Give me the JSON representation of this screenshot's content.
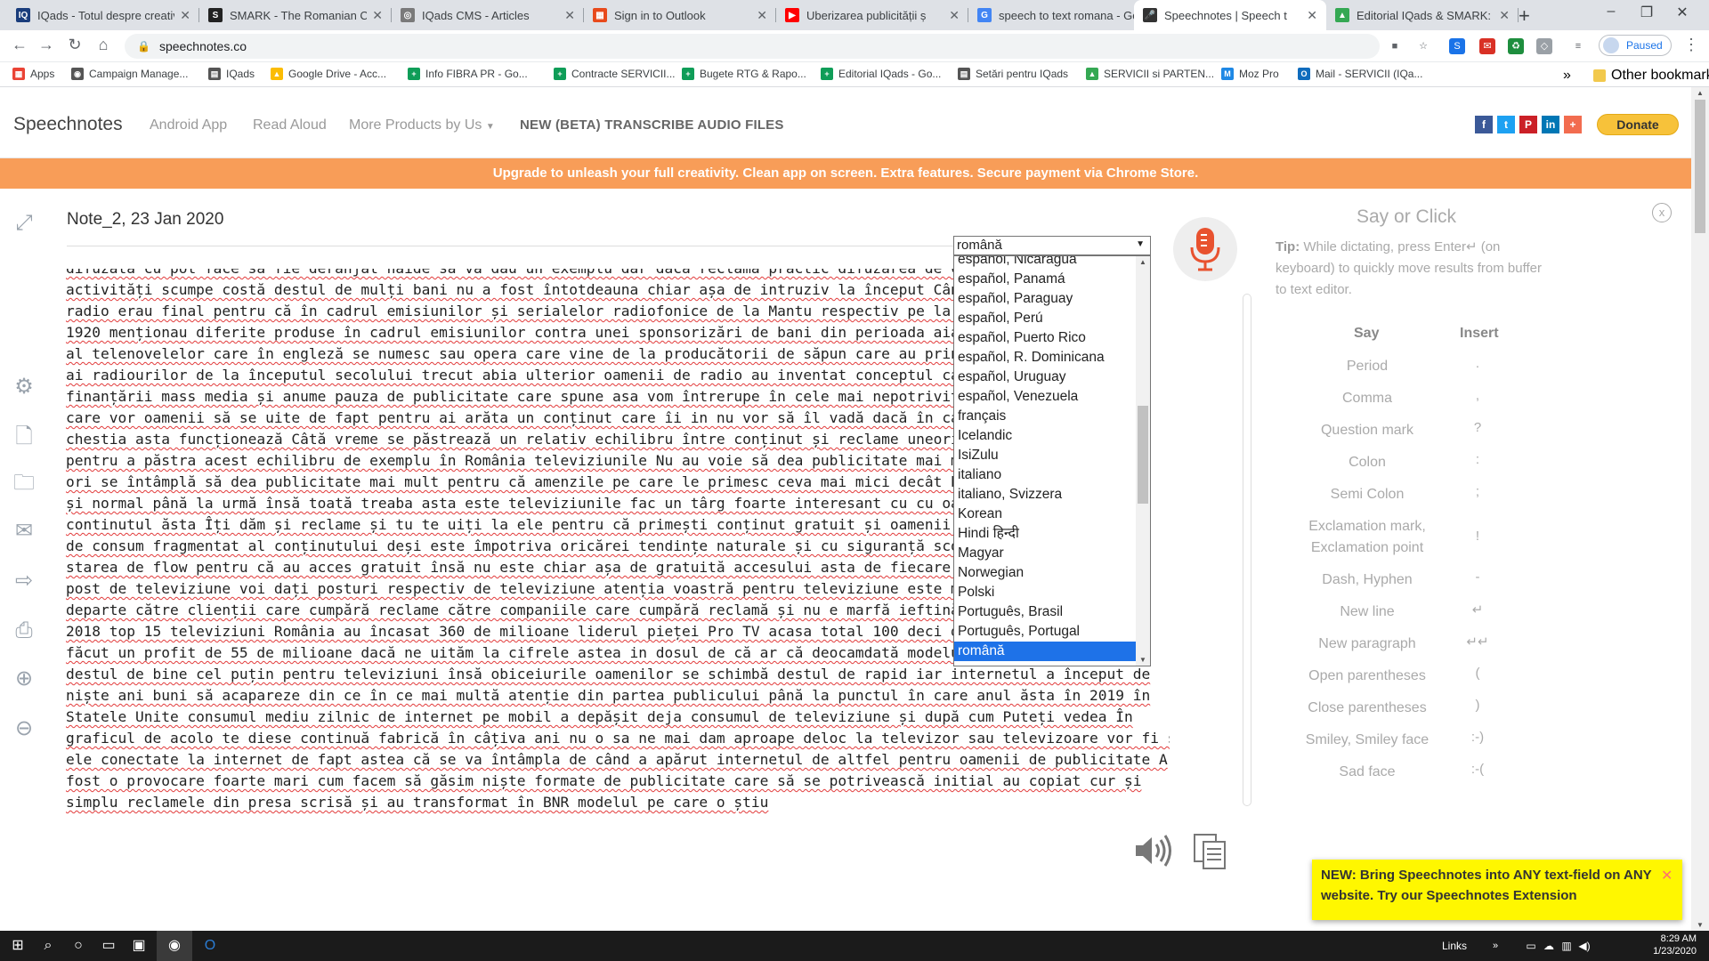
{
  "browser": {
    "tabs": [
      {
        "title": "IQads - Totul despre creativit",
        "fav": "IQ",
        "color": "#1a3d7c"
      },
      {
        "title": "SMARK - The Romanian Co",
        "fav": "S",
        "color": "#222222"
      },
      {
        "title": "IQads CMS - Articles",
        "fav": "◎",
        "color": "#7a7a7a"
      },
      {
        "title": "Sign in to Outlook",
        "fav": "▦",
        "color": "#e84a1c"
      },
      {
        "title": "Uberizarea publicității ș",
        "fav": "▶",
        "color": "#ff0000"
      },
      {
        "title": "speech to text romana - Go",
        "fav": "G",
        "color": "#4285f4"
      },
      {
        "title": "Speechnotes | Speech t",
        "fav": "🎤",
        "color": "#333333",
        "active": true
      },
      {
        "title": "Editorial IQads & SMARK: V",
        "fav": "▲",
        "color": "#34a853"
      }
    ],
    "new_tab": "+",
    "url": "speechnotes.co",
    "profile_status": "Paused",
    "bookmarks": [
      {
        "label": "Apps",
        "icon": "▦",
        "color": "#ea4335"
      },
      {
        "label": "Campaign Manage...",
        "icon": "◉",
        "color": "#555555"
      },
      {
        "label": "IQads",
        "icon": "▤",
        "color": "#555555"
      },
      {
        "label": "Google Drive - Acc...",
        "icon": "▲",
        "color": "#fbbc04"
      },
      {
        "label": "Info FIBRA PR - Go...",
        "icon": "+",
        "color": "#0f9d58"
      },
      {
        "label": "Contracte SERVICII...",
        "icon": "+",
        "color": "#0f9d58"
      },
      {
        "label": "Bugete RTG & Rapo...",
        "icon": "+",
        "color": "#0f9d58"
      },
      {
        "label": "Editorial IQads - Go...",
        "icon": "+",
        "color": "#0f9d58"
      },
      {
        "label": "Setări pentru IQads",
        "icon": "▤",
        "color": "#555555"
      },
      {
        "label": "SERVICII si PARTEN...",
        "icon": "▲",
        "color": "#34a853"
      },
      {
        "label": "Moz Pro",
        "icon": "M",
        "color": "#1e88e5"
      },
      {
        "label": "Mail - SERVICII (IQa...",
        "icon": "O",
        "color": "#0f6cbd"
      }
    ],
    "more_bookmarks": "»",
    "other_bookmarks": "Other bookmarks"
  },
  "header": {
    "brand": "Speechnotes",
    "nav": [
      "Android App",
      "Read Aloud",
      "More Products by Us"
    ],
    "nav_new": "NEW (BETA) TRANSCRIBE AUDIO FILES",
    "social": [
      {
        "icon": "f",
        "color": "#3b5998"
      },
      {
        "icon": "t",
        "color": "#1da1f2"
      },
      {
        "icon": "P",
        "color": "#cb2027"
      },
      {
        "icon": "in",
        "color": "#0077b5"
      },
      {
        "icon": "+",
        "color": "#f26c4f"
      }
    ],
    "donate": "Donate"
  },
  "banner": "Upgrade to unleash your full creativity. Clean app on screen. Extra features. Secure payment via Chrome Store.",
  "note": {
    "title": "Note_2, 23 Jan 2020",
    "lines": [
      "difuzată cu pot face să fie deranjat haide să vă dau un exemplu dar dacă reclama practic difuzarea de co",
      "activități scumpe costă destul de mulți bani nu a fost întotdeauna chiar așa de intruziv la început Când",
      "radio erau final pentru că în cadrul emisiunilor și serialelor radiofonice de la Mantu respectiv pe la i",
      "1920 menționau diferite produse în cadrul emisiunilor contra unei sponsorizări de bani din perioada aia",
      "al telenovelelor care în engleză se numesc sau opera care vine de la producătorii de săpun care au print",
      "ai radiourilor de la începutul secolului trecut abia ulterior oamenii de radio au inventat conceptul car",
      "finanțării mass media și anume pauza de publicitate care spune asa vom întrerupe în cele mai nepotrivite",
      "care vor oamenii să se uite de fapt pentru ai arăta un conținut care îi in nu vor să îl vadă dacă în car",
      "chestia asta funcționează Câtă vreme se păstrează un relativ echilibru între conținut și reclame uneori",
      "pentru a păstra acest echilibru de exemplu în România televiziunile Nu au voie să dea publicitate mai mu",
      "ori se întâmplă să dea publicitate mai mult pentru că amenzile pe care le primesc ceva mai mici decât ba",
      "și normal până la urmă însă toată treaba asta este televiziunile fac un târg foarte interesant cu cu oam",
      "continutul ăsta Îți dăm și reclame și tu te uiți la ele pentru că primești conținut gratuit și oamenii au",
      "de consum fragmentat al conținutului deși este împotriva oricărei tendințe naturale și cu siguranță scoa",
      "starea de flow pentru că au acces gratuit însă nu este chiar așa de gratuită accesului asta de fiecare d",
      "post de televiziune voi dați posturi respectiv de televiziune atenția voastră pentru televiziune este ma",
      "departe către clienții care cumpără reclame către companiile care cumpără reclamă și nu e marfă ieftină",
      "2018 top 15 televiziuni România au încasat 360 de milioane liderul pieței Pro TV acasa total 100 deci de",
      "făcut un profit de 55 de milioane dacă ne uităm la cifrele astea in dosul de că ar că deocamdată modelul",
      "destul de bine cel puțin pentru televiziuni însă obiceiurile oamenilor se schimbă destul de rapid iar internetul a început de",
      "niște ani buni să acapareze din ce în ce mai multă atenție din partea publicului până la punctul în care anul ăsta în 2019 în",
      "Statele Unite consumul mediu zilnic de internet pe mobil a depășit deja consumul de televiziune și după cum Puteți vedea În",
      "graficul de acolo te diese continuă fabrică în câțiva ani nu o sa ne mai dam aproape deloc la televizor sau televizoare vor fi și",
      "ele conectate la internet de fapt astea că se va întâmpla de când a apărut internetul de altfel pentru oamenii de publicitate A",
      "fost o provocare foarte mari cum facem să găsim niște formate de publicitate care să se potrivească initial au copiat cur și",
      "simplu reclamele din presa scrisă și au transformat în BNR modelul pe care o știu"
    ]
  },
  "language": {
    "selected": "română",
    "options": [
      "español, Nicaragua",
      "español, Panamá",
      "español, Paraguay",
      "español, Perú",
      "español, Puerto Rico",
      "español, R. Dominicana",
      "español, Uruguay",
      "español, Venezuela",
      "français",
      "Icelandic",
      "IsiZulu",
      "italiano",
      "italiano, Svizzera",
      "Korean",
      "Hindi हिन्दी",
      "Magyar",
      "Norwegian",
      "Polski",
      "Português, Brasil",
      "Português, Portugal",
      "română"
    ]
  },
  "panel": {
    "title": "Say or Click",
    "close": "x",
    "tip_label": "Tip:",
    "tip_text": " While dictating, press Enter↵ (on keyboard) to quickly move results from buffer to text editor.",
    "col_say": "Say",
    "col_insert": "Insert",
    "commands": [
      {
        "say": "Period",
        "insert": "."
      },
      {
        "say": "Comma",
        "insert": ","
      },
      {
        "say": "Question mark",
        "insert": "?"
      },
      {
        "say": "Colon",
        "insert": ":"
      },
      {
        "say": "Semi Colon",
        "insert": ";"
      },
      {
        "say": "Exclamation mark, Exclamation point",
        "insert": "!"
      },
      {
        "say": "Dash, Hyphen",
        "insert": "-"
      },
      {
        "say": "New line",
        "insert": "↵"
      },
      {
        "say": "New paragraph",
        "insert": "↵↵"
      },
      {
        "say": "Open parentheses",
        "insert": "("
      },
      {
        "say": "Close parentheses",
        "insert": ")"
      },
      {
        "say": "Smiley, Smiley face",
        "insert": ":-)"
      },
      {
        "say": "Sad face",
        "insert": ":-("
      }
    ]
  },
  "promo": {
    "text": "NEW: Bring Speechnotes into ANY text-field on ANY website. Try our Speechnotes Extension",
    "close": "✕"
  },
  "taskbar": {
    "links": "Links",
    "time": "8:29 AM",
    "date": "1/23/2020"
  },
  "colors": {
    "banner": "#f89d58",
    "donate": "#f7c23a",
    "mic": "#e8522f",
    "promo": "#fff700",
    "dropdown_selected": "#1e72e8"
  }
}
